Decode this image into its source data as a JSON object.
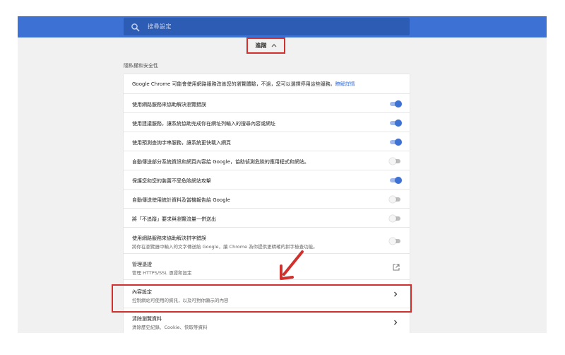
{
  "search": {
    "placeholder": "搜尋設定",
    "icon": "search-icon"
  },
  "advanced": {
    "label": "進階",
    "icon": "chevron-up-icon"
  },
  "section": {
    "title": "隱私權和安全性"
  },
  "intro": {
    "text": "Google Chrome 可能會使用網路服務改善您的瀏覽體驗，不過，您可以選擇停用這些服務。",
    "link": "瞭解詳情"
  },
  "toggles": [
    {
      "label": "使用網路服務來協助解決瀏覽錯誤",
      "on": true
    },
    {
      "label": "使用建議服務，讓系統協助完成你在網址列輸入的搜尋內容或網址",
      "on": true
    },
    {
      "label": "使用預測查詢字串服務，讓系統更快載入網頁",
      "on": true
    },
    {
      "label": "自動傳送部分系統資訊和網頁內容給 Google，協助偵測危險的應用程式和網站。",
      "on": false
    },
    {
      "label": "保護您和您的裝置不受危險網站攻擊",
      "on": true
    },
    {
      "label": "自動傳送使用統計資料及當機報告給 Google",
      "on": false
    },
    {
      "label": "將「不追蹤」要求與瀏覽流量一併送出",
      "on": false
    }
  ],
  "spell": {
    "title": "使用網路服務來協助解決拼字錯誤",
    "subtitle": "將你在瀏覽器中輸入的文字傳送給 Google，讓 Chrome 為你提供更精確的拼字檢查功能。",
    "on": false
  },
  "certs": {
    "title": "管理憑證",
    "subtitle": "管理 HTTPS/SSL 憑證和設定",
    "icon": "external-link-icon"
  },
  "content": {
    "title": "內容設定",
    "subtitle": "控制網站可使用的資訊，以及可對你顯示的內容",
    "icon": "chevron-right-icon"
  },
  "clear": {
    "title": "清除瀏覽資料",
    "subtitle": "清除歷史紀錄、Cookie、快取等資料",
    "icon": "chevron-right-icon"
  },
  "colors": {
    "accent": "#3d71d4",
    "highlight": "#d0312d"
  }
}
